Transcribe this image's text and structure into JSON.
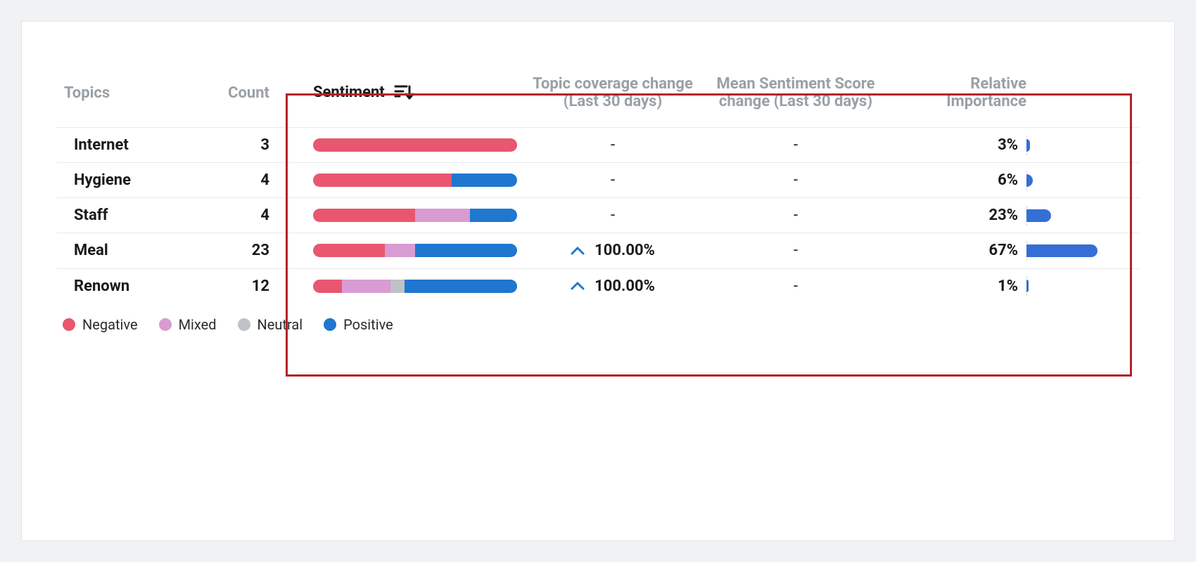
{
  "headers": {
    "topics": "Topics",
    "count": "Count",
    "sentiment": "Sentiment",
    "coverage": "Topic coverage change (Last 30 days)",
    "mean_score": "Mean Sentiment Score change (Last 30 days)",
    "importance": "Relative Importance"
  },
  "legend": {
    "negative": "Negative",
    "mixed": "Mixed",
    "neutral": "Neutral",
    "positive": "Positive"
  },
  "rows": [
    {
      "topic": "Internet",
      "count": "3",
      "coverage": "-",
      "cov_up": false,
      "mean_score": "-",
      "importance": "3%"
    },
    {
      "topic": "Hygiene",
      "count": "4",
      "coverage": "-",
      "cov_up": false,
      "mean_score": "-",
      "importance": "6%"
    },
    {
      "topic": "Staff",
      "count": "4",
      "coverage": "-",
      "cov_up": false,
      "mean_score": "-",
      "importance": "23%"
    },
    {
      "topic": "Meal",
      "count": "23",
      "coverage": "100.00%",
      "cov_up": true,
      "mean_score": "-",
      "importance": "67%"
    },
    {
      "topic": "Renown",
      "count": "12",
      "coverage": "100.00%",
      "cov_up": true,
      "mean_score": "-",
      "importance": "1%"
    }
  ],
  "chart_data": {
    "type": "table",
    "title": "Topic sentiment breakdown",
    "columns": [
      "Topics",
      "Count",
      "Sentiment (neg/mixed/neutral/positive %)",
      "Topic coverage change (Last 30 days)",
      "Mean Sentiment Score change (Last 30 days)",
      "Relative Importance"
    ],
    "sort": {
      "column": "Sentiment",
      "direction": "desc"
    },
    "highlight_columns": [
      "Sentiment",
      "Topic coverage change (Last 30 days)",
      "Mean Sentiment Score change (Last 30 days)",
      "Relative Importance"
    ],
    "legend": [
      "Negative",
      "Mixed",
      "Neutral",
      "Positive"
    ],
    "colors": {
      "negative": "#e8576f",
      "mixed": "#d99bd3",
      "neutral": "#bfc2c6",
      "positive": "#1f77d0"
    },
    "importance_range": [
      0,
      100
    ],
    "rows": [
      {
        "topic": "Internet",
        "count": 3,
        "sentiment_pct": {
          "negative": 100,
          "mixed": 0,
          "neutral": 0,
          "positive": 0
        },
        "coverage_change": null,
        "mean_score_change": null,
        "relative_importance_pct": 3
      },
      {
        "topic": "Hygiene",
        "count": 4,
        "sentiment_pct": {
          "negative": 68,
          "mixed": 0,
          "neutral": 0,
          "positive": 32
        },
        "coverage_change": null,
        "mean_score_change": null,
        "relative_importance_pct": 6
      },
      {
        "topic": "Staff",
        "count": 4,
        "sentiment_pct": {
          "negative": 50,
          "mixed": 27,
          "neutral": 0,
          "positive": 23
        },
        "coverage_change": null,
        "mean_score_change": null,
        "relative_importance_pct": 23
      },
      {
        "topic": "Meal",
        "count": 23,
        "sentiment_pct": {
          "negative": 35,
          "mixed": 15,
          "neutral": 0,
          "positive": 50
        },
        "coverage_change": 100.0,
        "mean_score_change": null,
        "relative_importance_pct": 67
      },
      {
        "topic": "Renown",
        "count": 12,
        "sentiment_pct": {
          "negative": 14,
          "mixed": 24,
          "neutral": 7,
          "positive": 55
        },
        "coverage_change": 100.0,
        "mean_score_change": null,
        "relative_importance_pct": 1
      }
    ]
  }
}
